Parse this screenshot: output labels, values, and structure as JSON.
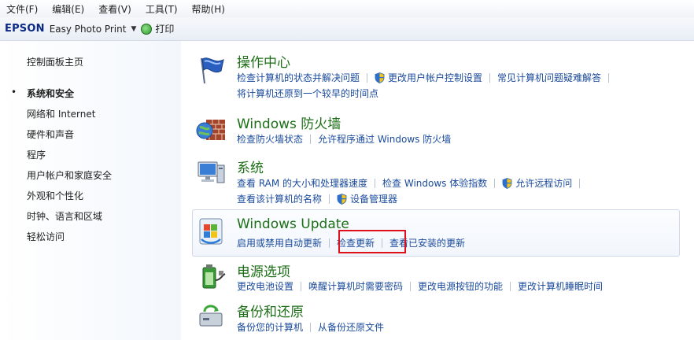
{
  "menubar": {
    "items": [
      "文件(F)",
      "编辑(E)",
      "查看(V)",
      "工具(T)",
      "帮助(H)"
    ]
  },
  "toolbar": {
    "brand": "EPSON",
    "app": "Easy Photo Print",
    "print_label": "打印"
  },
  "sidebar": {
    "home": "控制面板主页",
    "items": [
      {
        "label": "系统和安全",
        "active": true
      },
      {
        "label": "网络和 Internet"
      },
      {
        "label": "硬件和声音"
      },
      {
        "label": "程序"
      },
      {
        "label": "用户帐户和家庭安全"
      },
      {
        "label": "外观和个性化"
      },
      {
        "label": "时钟、语言和区域"
      },
      {
        "label": "轻松访问"
      }
    ]
  },
  "categories": [
    {
      "title": "操作中心",
      "icon": "action-center-flag-icon",
      "links": [
        [
          "检查计算机的状态并解决问题",
          "更改用户帐户控制设置",
          "常见计算机问题疑难解答"
        ],
        [
          "将计算机还原到一个较早的时间点"
        ]
      ]
    },
    {
      "title": "Windows 防火墙",
      "icon": "firewall-icon",
      "links": [
        [
          "检查防火墙状态",
          "允许程序通过 Windows 防火墙"
        ]
      ]
    },
    {
      "title": "系统",
      "icon": "system-computer-icon",
      "links": [
        [
          "查看 RAM 的大小和处理器速度",
          "检查 Windows 体验指数",
          "允许远程访问"
        ],
        [
          "查看该计算机的名称",
          "设备管理器"
        ]
      ]
    },
    {
      "title": "Windows Update",
      "icon": "windows-update-icon",
      "links": [
        [
          "启用或禁用自动更新",
          "检查更新",
          "查看已安装的更新"
        ]
      ]
    },
    {
      "title": "电源选项",
      "icon": "power-options-icon",
      "links": [
        [
          "更改电池设置",
          "唤醒计算机时需要密码",
          "更改电源按钮的功能",
          "更改计算机睡眠时间"
        ]
      ]
    },
    {
      "title": "备份和还原",
      "icon": "backup-restore-icon",
      "links": [
        [
          "备份您的计算机",
          "从备份还原文件"
        ]
      ]
    }
  ],
  "colors": {
    "category_title": "#1c6f16",
    "link": "#1a4a9c",
    "highlight": "#e0101a"
  }
}
